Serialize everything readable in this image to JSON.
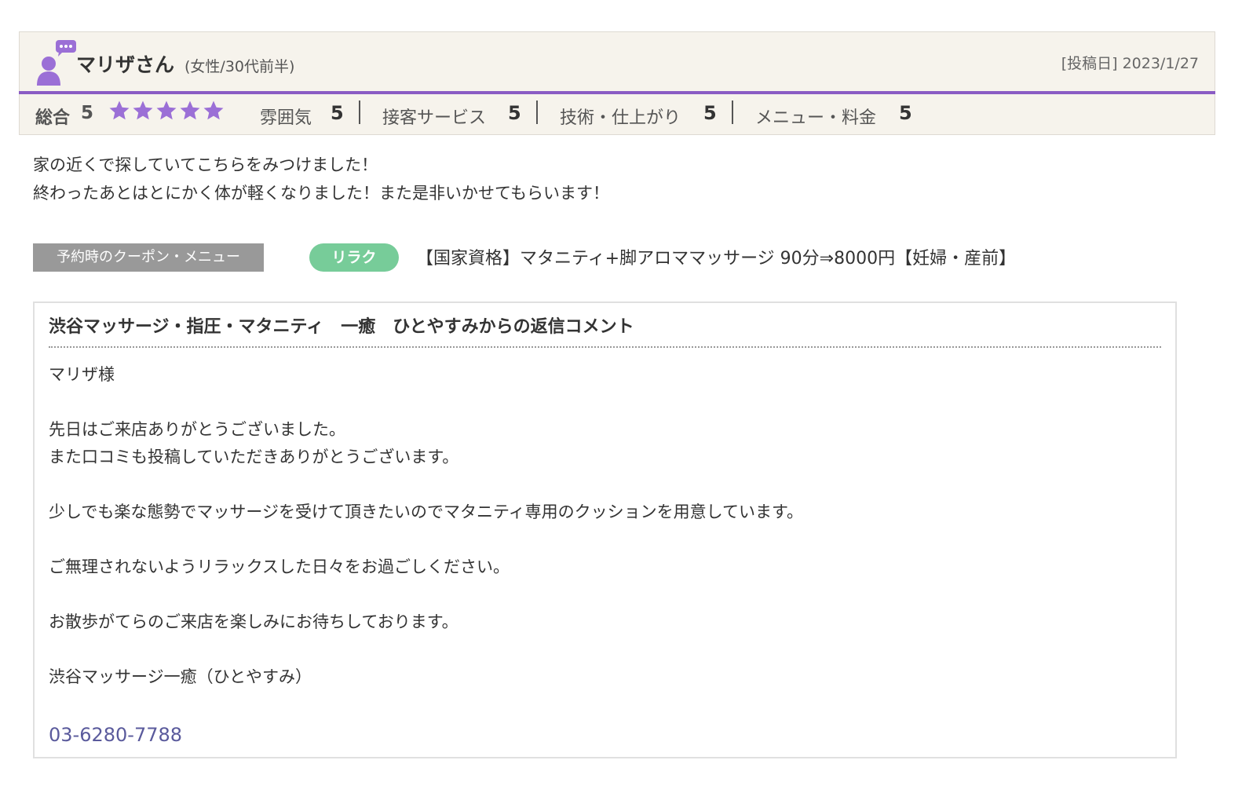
{
  "review": {
    "user_name": "マリザさん",
    "user_attributes": "(女性/30代前半)",
    "post_date": "[投稿日] 2023/1/27",
    "overall_label": "総合",
    "overall_score": "5",
    "star_rating": 5,
    "star_max": 5,
    "categories": [
      {
        "label": "雰囲気",
        "score": "5"
      },
      {
        "label": "接客サービス",
        "score": "5"
      },
      {
        "label": "技術・仕上がり",
        "score": "5"
      },
      {
        "label": "メニュー・料金",
        "score": "5"
      }
    ],
    "body_lines": [
      "家の近くで探していてこちらをみつけました！",
      "終わったあとはとにかく体が軽くなりました！また是非いかせてもらいます！"
    ]
  },
  "coupon": {
    "label": "予約時のクーポン・メニュー",
    "category": "リラク",
    "name": "【国家資格】マタニティ+脚アロママッサージ 90分⇒8000円【妊婦・産前】"
  },
  "reply": {
    "title": "渋谷マッサージ・指圧・マタニティ　一癒　ひとやすみからの返信コメント",
    "lines": [
      "マリザ様",
      "",
      "先日はご来店ありがとうございました。",
      "また口コミも投稿していただきありがとうございます。",
      "",
      "少しでも楽な態勢でマッサージを受けて頂きたいのでマタニティ専用のクッションを用意しています。",
      "",
      "ご無理されないようリラックスした日々をお過ごしください。",
      "",
      "お散歩がてらのご来店を楽しみにお待ちしております。",
      "",
      "渋谷マッサージ一癒（ひとやすみ）"
    ],
    "phone": "03-6280-7788"
  },
  "colors": {
    "accent_purple": "#8a5cc4",
    "star": "#9b6fd6",
    "header_bg": "#f6f3ec",
    "badge_green": "#77cc99",
    "label_gray": "#999999",
    "phone_link": "#5a5a9c"
  },
  "icons": {
    "avatar": "user-speech-bubble-icon",
    "star": "star-icon"
  }
}
